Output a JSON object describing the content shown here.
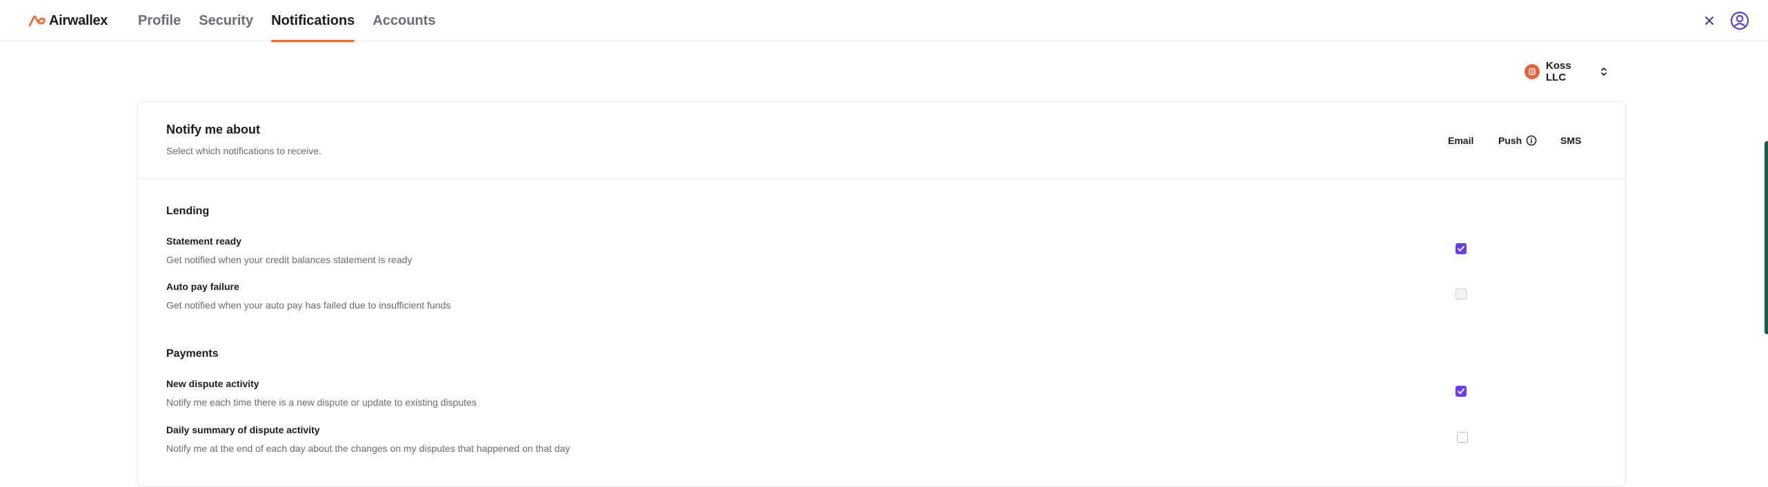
{
  "app": {
    "brand": "Airwallex",
    "brand_color": "#f4692f",
    "accent_color": "#6b3df0"
  },
  "nav": {
    "tabs": [
      {
        "label": "Profile",
        "active": false
      },
      {
        "label": "Security",
        "active": false
      },
      {
        "label": "Notifications",
        "active": true
      },
      {
        "label": "Accounts",
        "active": false
      }
    ],
    "close_icon": "close-icon",
    "avatar_icon": "user-circle-icon"
  },
  "account_switcher": {
    "name": "Koss LLC",
    "icon": "building-icon",
    "chevron_icon": "chevron-up-down-icon"
  },
  "notifications": {
    "title": "Notify me about",
    "subtitle": "Select which notifications to receive.",
    "channels": {
      "email": "Email",
      "push": "Push",
      "sms": "SMS"
    },
    "sections": [
      {
        "title": "Lending",
        "items": [
          {
            "title": "Statement ready",
            "description": "Get notified when your credit balances statement is ready",
            "email_checked": true
          },
          {
            "title": "Auto pay failure",
            "description": "Get notified when your auto pay has failed due to insufficient funds",
            "email_checked": false
          }
        ]
      },
      {
        "title": "Payments",
        "items": [
          {
            "title": "New dispute activity",
            "description": "Notify me each time there is a new dispute or update to existing disputes",
            "email_checked": true
          },
          {
            "title": "Daily summary of dispute activity",
            "description": "Notify me at the end of each day about the changes on my disputes that happened on that day",
            "email_checked": false
          }
        ]
      }
    ]
  }
}
